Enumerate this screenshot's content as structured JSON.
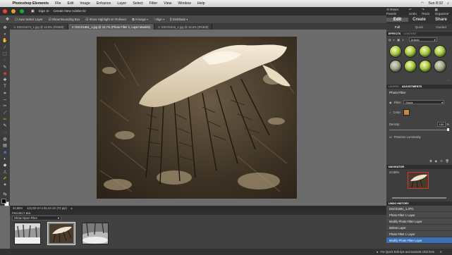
{
  "menubar": {
    "app_name": "Photoshop Elements",
    "items": [
      "File",
      "Edit",
      "Image",
      "Enhance",
      "Layer",
      "Select",
      "Filter",
      "View",
      "Window",
      "Help"
    ],
    "clock": "Sun 8:32",
    "wifi_icon": "wifi-icon",
    "search_icon": "search-icon"
  },
  "titlebar": {
    "sign_in": "Sign In",
    "create_id": "Create New Adobe ID",
    "reset_panels": "Reset Panels",
    "undo": "Undo",
    "redo": "Redo",
    "organizer": "Organizer"
  },
  "options": {
    "auto_select": "Auto Select Layer",
    "bounding_box": "Show Bounding Box",
    "highlight": "Show Highlight on Rollover",
    "arrange": "Arrange",
    "align": "Align",
    "distribute": "Distribute"
  },
  "tabs": [
    {
      "label": "DSC01674_1.jpg @ 16,6% (RGB/8)"
    },
    {
      "label": "DSC01861_1.jpg @ 24,7% (Photo Filter 1, Layer Mask/8)"
    },
    {
      "label": "DSC01615_1.jpg @ 16,6% (RGB/8)"
    }
  ],
  "status": {
    "zoom": "24,66%",
    "size": "121,92 cm x 91,44 cm (72 ppi)"
  },
  "project_bin": {
    "header": "PROJECT BIN",
    "selector": "Show Open Files"
  },
  "panel": {
    "modes": [
      "Edit",
      "Create",
      "Share"
    ],
    "submodes": [
      "Full",
      "Quick",
      "Guided"
    ],
    "effects_tabs": [
      "EFFECTS",
      "CONTENT"
    ],
    "filter_dropdown": "Artistic",
    "layers_tabs": [
      "LAYERS",
      "ADJUSTMENTS"
    ],
    "adj_title": "Photo Filter",
    "filter_label": "Filter:",
    "filter_value": "Sepia",
    "color_label": "Color:",
    "density_label": "Density:",
    "density_value": "100",
    "density_unit": "%",
    "luminosity_label": "Preserve Luminosity",
    "luminosity_checked": true,
    "navigator_title": "NAVIGATOR",
    "nav_zoom": "24,66%",
    "undo_title": "UNDO HISTORY",
    "undo_items": [
      "DSC01861_1.JPG",
      "Photo Filter 1 Layer",
      "Modify Photo Filter Layer",
      "Delete Layer",
      "Photo Filter 1 Layer",
      "Modify Photo Filter Layer"
    ],
    "accent": "#3b6fb6"
  },
  "bottombar": {
    "tip": "For Quick Edit tips and tutorials click here"
  },
  "colors": {
    "filter_swatch": "#c58a3a",
    "foreground": "#000000",
    "background": "#ffffff"
  }
}
